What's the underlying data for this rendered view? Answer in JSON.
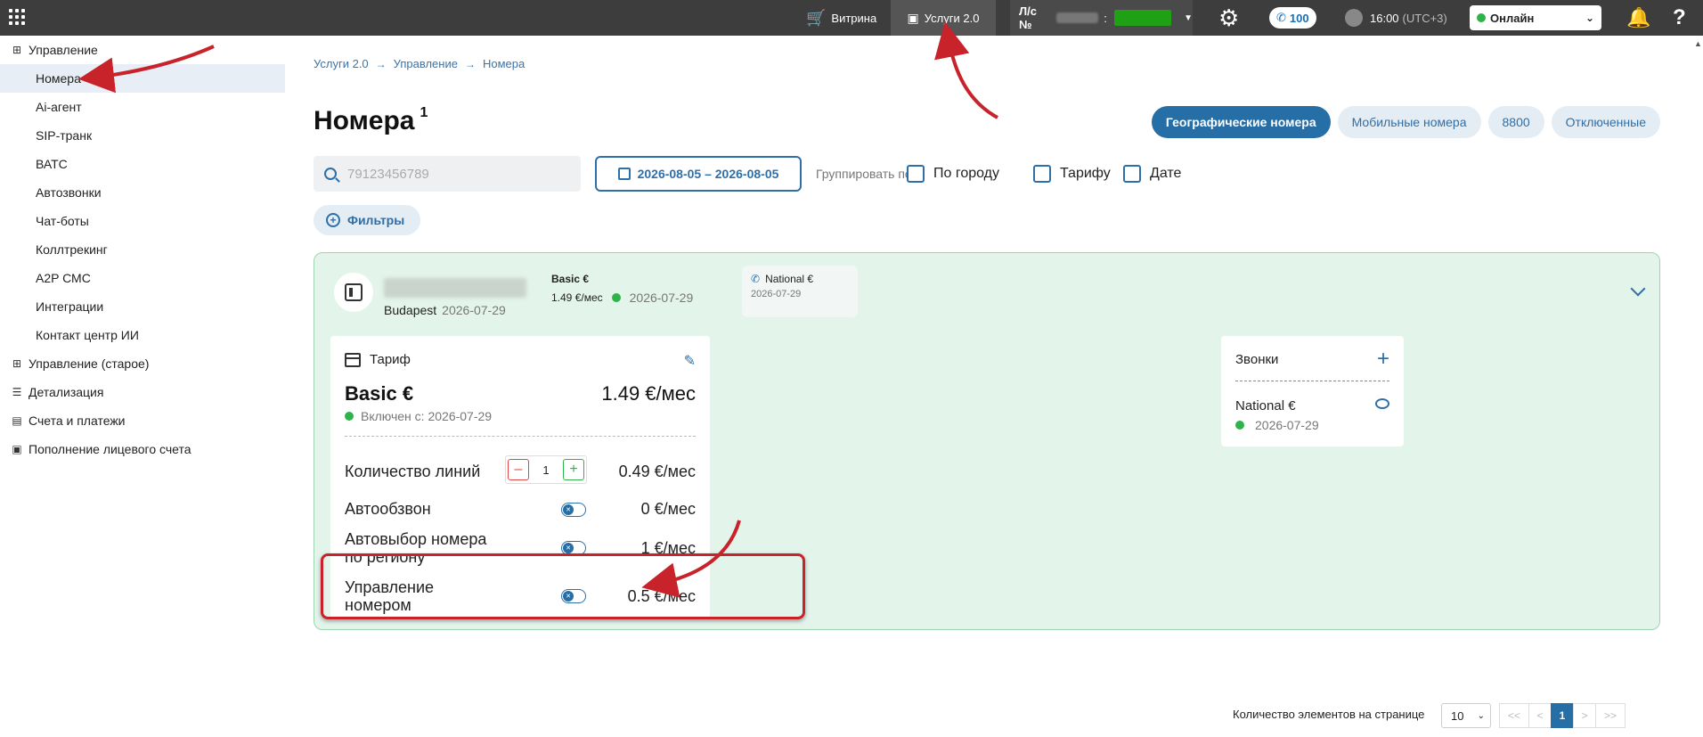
{
  "topbar": {
    "vitrina": "Витрина",
    "uslugi": "Услуги 2.0",
    "account_label": "Л/с №",
    "account_sep": ":",
    "calls_count": "100",
    "time": "16:00",
    "timezone": "(UTC+3)",
    "status": "Онлайн"
  },
  "sidebar": {
    "sections": [
      {
        "label": "Управление",
        "icon": "grid-icon"
      },
      {
        "label": "Управление (старое)",
        "icon": "grid-icon"
      },
      {
        "label": "Детализация",
        "icon": "database-icon"
      },
      {
        "label": "Счета и платежи",
        "icon": "receipt-icon"
      },
      {
        "label": "Пополнение лицевого счета",
        "icon": "wallet-icon"
      }
    ],
    "items": [
      "Номера",
      "Ai-агент",
      "SIP-транк",
      "ВАТС",
      "Автозвонки",
      "Чат-боты",
      "Коллтрекинг",
      "A2P СМС",
      "Интеграции",
      "Контакт центр ИИ"
    ],
    "active_item": "Номера"
  },
  "breadcrumb": [
    "Услуги 2.0",
    "Управление",
    "Номера"
  ],
  "page": {
    "title": "Номера",
    "count": "1"
  },
  "tabs": [
    {
      "label": "Географические номера",
      "active": true
    },
    {
      "label": "Мобильные номера",
      "active": false
    },
    {
      "label": "8800",
      "active": false
    },
    {
      "label": "Отключенные",
      "active": false
    }
  ],
  "search": {
    "placeholder": "79123456789"
  },
  "daterange": "2026-08-05 – 2026-08-05",
  "group_by": {
    "label": "Группировать по:",
    "options": [
      "По городу",
      "Тарифу",
      "Дате"
    ]
  },
  "filters_label": "Фильтры",
  "number_card": {
    "city": "Budapest",
    "date": "2026-07-29",
    "tariff_name": "Basic €",
    "tariff_price": "1.49 €/мес",
    "tariff_date": "2026-07-29",
    "service_name": "National €",
    "service_date": "2026-07-29"
  },
  "tariff_panel": {
    "header": "Тариф",
    "name": "Basic €",
    "total": "1.49 €/мес",
    "since": "Включен с: 2026-07-29",
    "rows": [
      {
        "label": "Количество линий",
        "price": "0.49 €/мес",
        "stepper_value": "1"
      },
      {
        "label": "Автообзвон",
        "price": "0 €/мес"
      },
      {
        "label": "Автовыбор номера\nпо региону",
        "price": "1 €/мес"
      },
      {
        "label": "Управление\nномером",
        "price": "0.5 €/мес"
      }
    ]
  },
  "calls_panel": {
    "title": "Звонки",
    "service_name": "National €",
    "service_date": "2026-07-29"
  },
  "pagination": {
    "per_page_label": "Количество элементов на странице",
    "per_page": "10",
    "first": "<<",
    "prev": "<",
    "current": "1",
    "next": ">",
    "last": ">>"
  },
  "colors": {
    "primary": "#266ea6",
    "card_bg": "#e3f4ea",
    "online": "#2db34a",
    "annotation": "#c8232b"
  }
}
